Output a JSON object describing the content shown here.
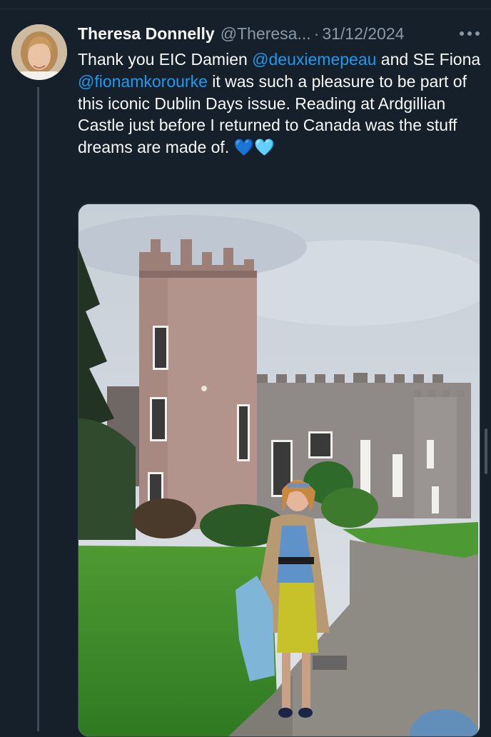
{
  "tweet": {
    "author_name": "Theresa Donnelly",
    "handle": "@Theresa...",
    "separator": "·",
    "date": "31/12/2024",
    "text_segments": {
      "s1": "Thank you EIC Damien ",
      "m1": "@deuxiemepeau",
      "s2": " and SE Fiona ",
      "m2": "@fionamkorourke",
      "s3": " it was such a pleasure to be part of this iconic Dublin Days issue. Reading at Ardgillian Castle just before I returned to Canada was the stuff dreams are made of. ",
      "emoji": "💙🩵"
    }
  },
  "icons": {
    "more": "more-horizontal-icon",
    "avatar": "profile-photo"
  },
  "colors": {
    "background": "#15202b",
    "text": "#f7f9f9",
    "muted": "#8b98a5",
    "link": "#1d9bf0",
    "thread_line": "#3e4a56"
  }
}
